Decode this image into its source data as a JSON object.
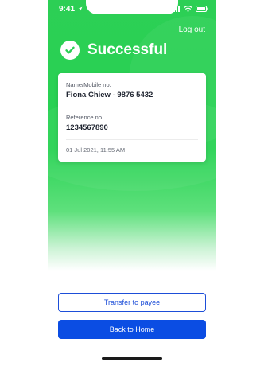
{
  "status_bar": {
    "time": "9:41"
  },
  "header": {
    "logout_label": "Log out"
  },
  "status": {
    "title": "Successful"
  },
  "receipt": {
    "name_label": "Name/Mobile no.",
    "name_value": "Fiona Chiew - 9876 5432",
    "reference_label": "Reference no.",
    "reference_value": "1234567890",
    "timestamp": "01 Jul 2021, 11:55 AM"
  },
  "actions": {
    "transfer_label": "Transfer to payee",
    "home_label": "Back to Home"
  },
  "colors": {
    "success_green": "#2ccf55",
    "primary_blue": "#0b4de3",
    "outline_blue": "#1d4ed8"
  },
  "icons": [
    "location-arrow-icon",
    "signal-icon",
    "wifi-icon",
    "battery-icon",
    "checkmark-icon"
  ]
}
